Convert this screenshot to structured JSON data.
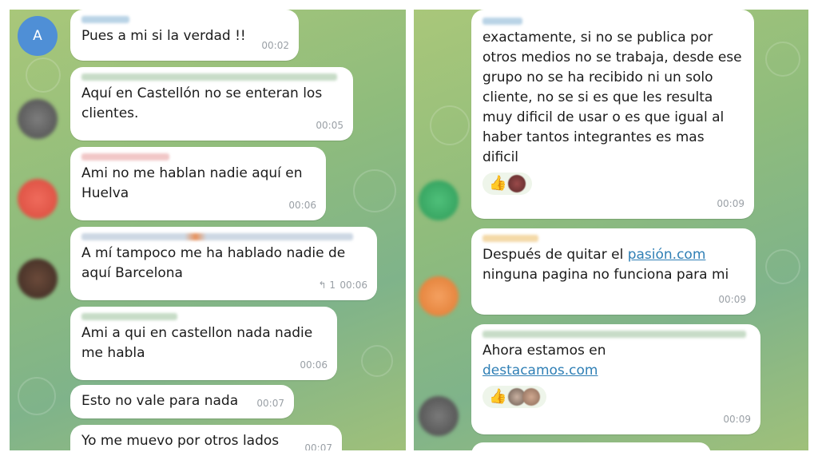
{
  "left_panel": {
    "messages": [
      {
        "avatar_letter": "A",
        "text": "Pues a mi si la verdad !!",
        "time": "00:02"
      },
      {
        "text": "Aquí en Castellón no se enteran los clientes.",
        "time": "00:05"
      },
      {
        "text": "Ami no me hablan nadie aquí en Huelva",
        "time": "00:06"
      },
      {
        "text": "A mí tampoco me ha hablado nadie de aquí Barcelona",
        "time": "00:06",
        "replies": "1"
      },
      {
        "text": "Ami a qui en castellon nada nadie me habla",
        "time": "00:06"
      },
      {
        "text": "Esto no vale para nada",
        "time": "00:07"
      },
      {
        "text": "Yo me muevo por otros lados",
        "time": "00:07"
      }
    ]
  },
  "right_panel": {
    "messages": [
      {
        "text": "exactamente, si no se publica por otros medios no se trabaja, desde ese grupo no se ha recibido ni un solo cliente, no se si es que les resulta muy dificil de usar o es que igual al haber tantos integrantes es mas dificil",
        "time": "00:09",
        "reaction_icon": "thumbs-up"
      },
      {
        "text_before": "Después de quitar el ",
        "link": "pasión.com",
        "text_after": "ninguna pagina no funciona para mi",
        "time": "00:09"
      },
      {
        "text_before": "Ahora estamos en",
        "link": "destacamos.com",
        "time": "00:09",
        "reaction_icon": "thumbs-up"
      }
    ]
  },
  "colors": {
    "chat_bg": "#8fbc7c",
    "bubble": "#ffffff",
    "time_text": "#9aa0a6",
    "link": "#2f7fb5",
    "avatar_blue": "#4f8fd6"
  }
}
